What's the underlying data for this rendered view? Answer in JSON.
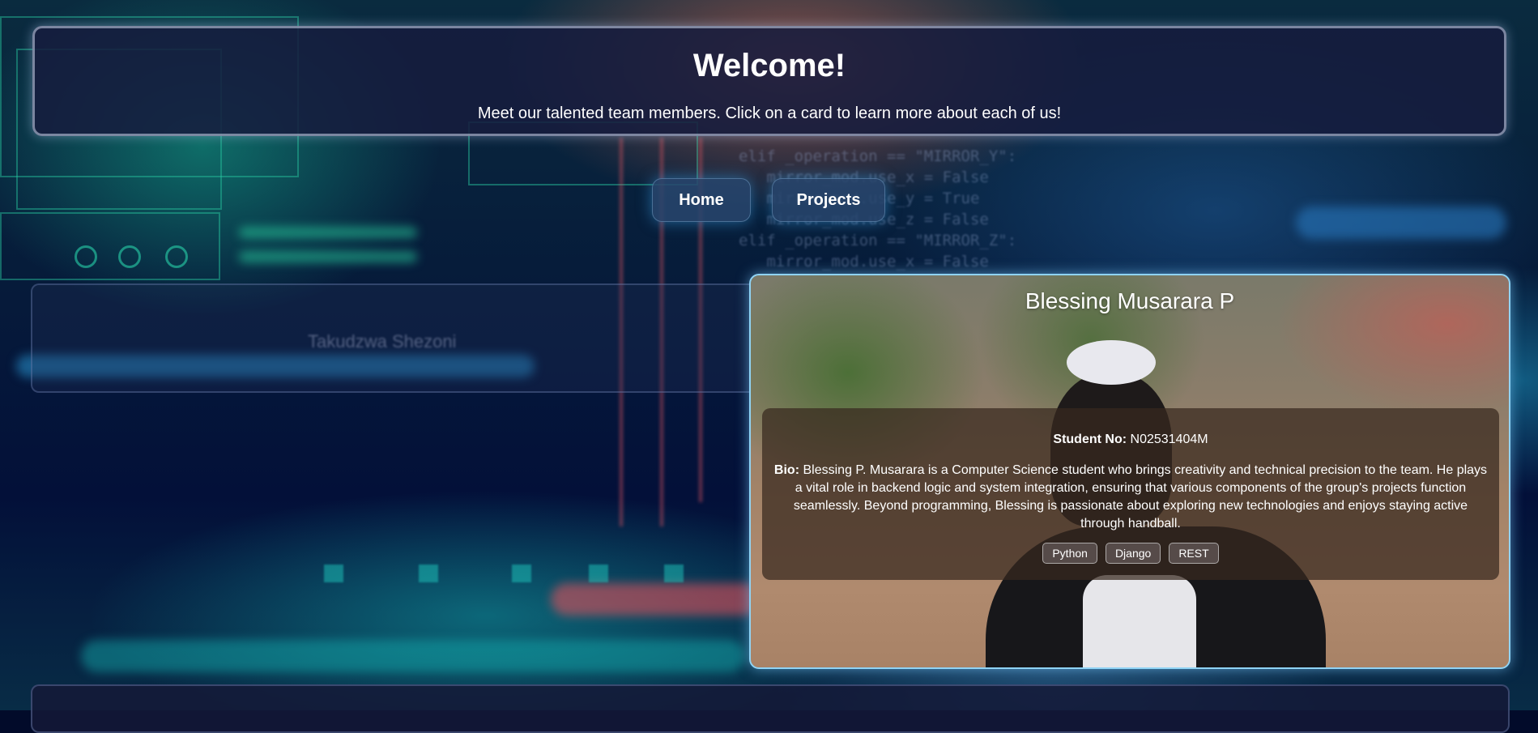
{
  "header": {
    "title": "Welcome!",
    "subtitle": "Meet our talented team members. Click on a card to learn more about each of us!"
  },
  "nav": {
    "home_label": "Home",
    "projects_label": "Projects"
  },
  "background_card": {
    "name": "Takudzwa Shezoni"
  },
  "profile": {
    "name": "Blessing Musarara P",
    "student_no_label": "Student No:",
    "student_no": "N02531404M",
    "bio_label": "Bio:",
    "bio": "Blessing P. Musarara is a Computer Science student who brings creativity and technical precision to the team. He plays a vital role in backend logic and system integration, ensuring that various components of the group's projects function seamlessly. Beyond programming, Blessing is passionate about exploring new technologies and enjoys staying active through handball.",
    "skills": [
      "Python",
      "Django",
      "REST"
    ]
  },
  "colors": {
    "card_border": "#8fd3f5",
    "header_bg": "#161c3e",
    "page_bg": "#020b2a"
  }
}
